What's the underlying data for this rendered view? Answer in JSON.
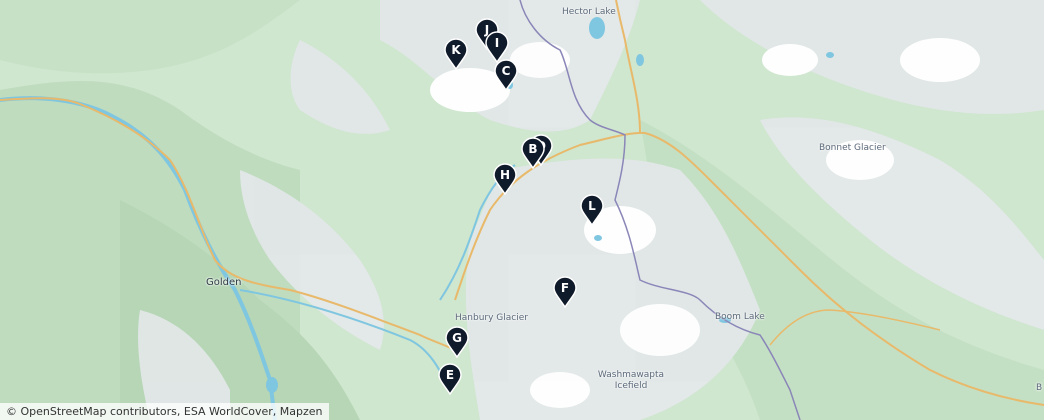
{
  "map": {
    "attribution": "© OpenStreetMap contributors, ESA WorldCover, Mapzen",
    "places": [
      {
        "id": "hector-lake",
        "name": "Hector Lake",
        "type": "lake"
      },
      {
        "id": "golden",
        "name": "Golden",
        "type": "town"
      },
      {
        "id": "bonnet-glacier",
        "name": "Bonnet Glacier",
        "type": "glacier"
      },
      {
        "id": "hanbury-glacier",
        "name": "Hanbury Glacier",
        "type": "glacier"
      },
      {
        "id": "boom-lake",
        "name": "Boom Lake",
        "type": "lake"
      },
      {
        "id": "washmawapta-icefield",
        "name": "Washmawapta Icefield",
        "type": "glacier"
      }
    ],
    "edge_label": "B",
    "markers": [
      {
        "label": "J",
        "color": "#0f1a2b"
      },
      {
        "label": "I",
        "color": "#0f1a2b"
      },
      {
        "label": "K",
        "color": "#0f1a2b"
      },
      {
        "label": "C",
        "color": "#0f1a2b"
      },
      {
        "label": "D",
        "color": "#0f1a2b"
      },
      {
        "label": "B",
        "color": "#0f1a2b"
      },
      {
        "label": "H",
        "color": "#0f1a2b"
      },
      {
        "label": "L",
        "color": "#0f1a2b"
      },
      {
        "label": "F",
        "color": "#0f1a2b"
      },
      {
        "label": "G",
        "color": "#0f1a2b"
      },
      {
        "label": "E",
        "color": "#0f1a2b"
      }
    ]
  }
}
